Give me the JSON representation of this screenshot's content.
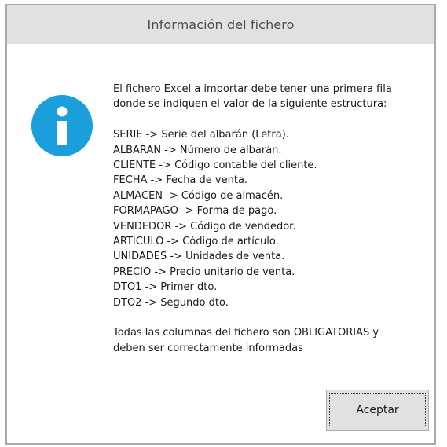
{
  "window": {
    "title": "Información del fichero"
  },
  "icon": {
    "name": "info-icon",
    "color": "#1a9fdc"
  },
  "message": {
    "intro": [
      "El fichero Excel a importar debe tener una primera fila",
      "donde se indiquen el valor de la siguiente estructura:"
    ],
    "fields": [
      "SERIE -> Serie del albarán (Letra).",
      "ALBARAN -> Número de albarán.",
      "CLIENTE -> Código contable del cliente.",
      "FECHA -> Fecha de venta.",
      "ALMACEN -> Código de almacén.",
      "FORMAPAGO -> Forma de pago.",
      "VENDEDOR -> Código de vendedor.",
      "ARTICULO -> Código de artículo.",
      "UNIDADES -> Unidades de venta.",
      "PRECIO -> Precio unitario de venta.",
      "DTO1 -> Primer dto.",
      "DTO2 -> Segundo dto."
    ],
    "footer": [
      "Todas las columnas del fichero son OBLIGATORIAS y",
      "deben ser correctamente informadas"
    ]
  },
  "buttons": {
    "accept_label": "Aceptar"
  }
}
